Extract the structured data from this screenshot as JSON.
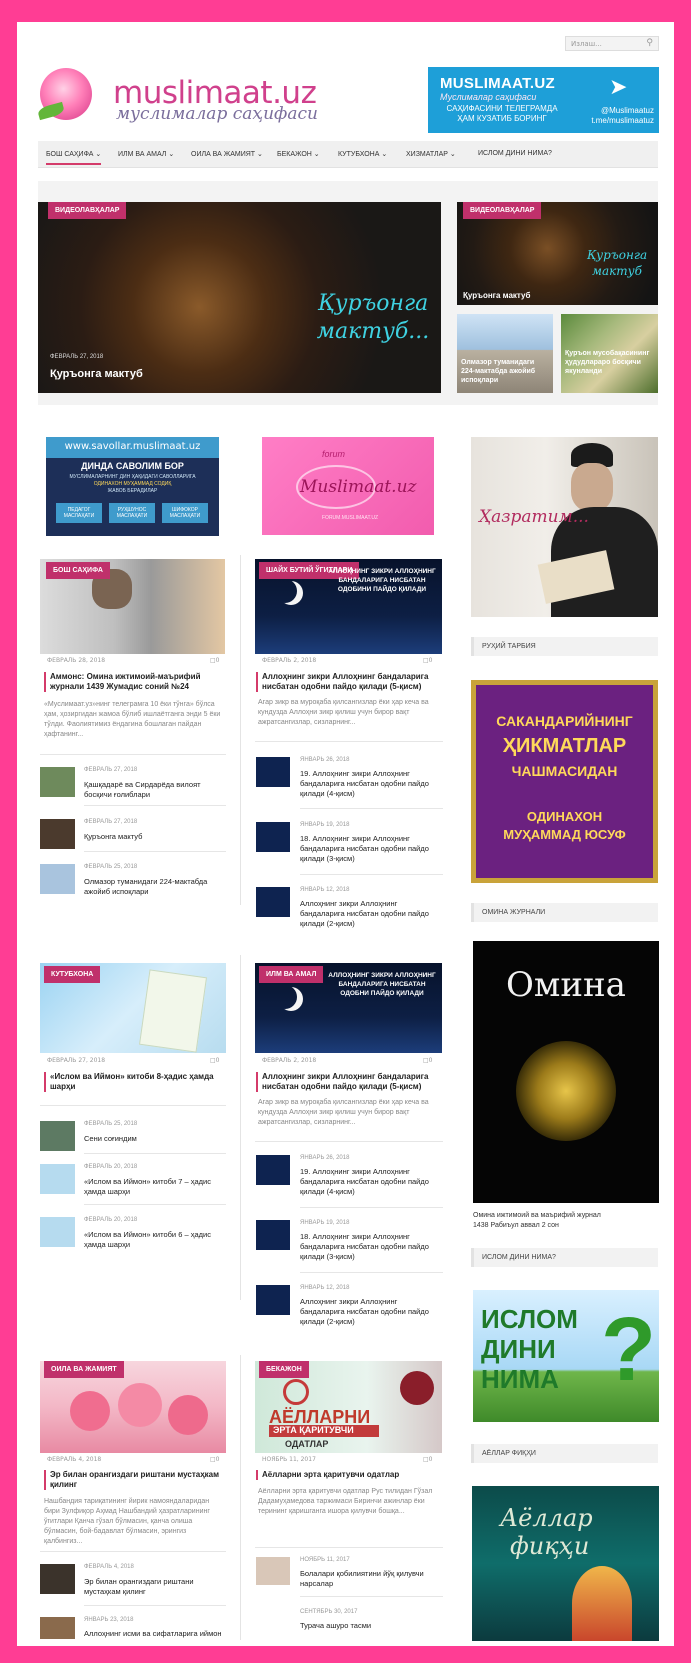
{
  "search": {
    "placeholder": "Излаш..."
  },
  "logo": {
    "title": "muslimaat.uz",
    "subtitle": "муслималар саҳифаси"
  },
  "telegram": {
    "title": "MUSLIMAAT.UZ",
    "subtitle": "Муслималар саҳифаси",
    "line1": "САҲИФАСИНИ ТЕЛЕГРАМДА",
    "line2": "ҲАМ КУЗАТИБ БОРИНГ",
    "handle": "@Muslimaatuz",
    "url": "t.me/muslimaatuz"
  },
  "nav": [
    {
      "label": "БОШ САҲИФА ⌄"
    },
    {
      "label": "ИЛМ ВА АМАЛ ⌄"
    },
    {
      "label": "ОИЛА ВА ЖАМИЯТ ⌄"
    },
    {
      "label": "БЕКАЖОН ⌄"
    },
    {
      "label": "КУТУБХОНА ⌄"
    },
    {
      "label": "ХИЗМАТЛАР ⌄"
    },
    {
      "label": "ИСЛОМ ДИНИ НИМА?"
    }
  ],
  "featured": {
    "main": {
      "tag": "ВИДЕОЛАВҲАЛАР",
      "date": "ФЕВРАЛЬ 27, 2018",
      "title": "Қуръонга мактуб",
      "art": "Қуръонга мактуб..."
    },
    "side1": {
      "tag": "ВИДЕОЛАВҲАЛАР",
      "title": "Қуръонга мактуб",
      "art": "Қуръонга мактуб"
    },
    "side2": {
      "title": "Олмазор туманидаги 224-мактабда ажойиб испоқлари"
    },
    "side3": {
      "title": "Қуръон мусобақасининг ҳудудлараро босқичи якунланди"
    }
  },
  "banners": {
    "savollar": {
      "url": "www.savollar.muslimaat.uz",
      "line1": "ДИНДА САВОЛИМ БОР",
      "line2": "МУСЛИМАЛАРНИНГ ДИН ҲАҚИДАГИ САВОЛЛАРИГА",
      "line3": "ОДИНАХОН МУҲАММАД СОДИҚ",
      "line4": "ЖАВОБ БЕРАДИЛАР",
      "b1": "ПЕДАГОГ МАСЛАҲАТИ",
      "b2": "РУҲШУНОС МАСЛАҲАТИ",
      "b3": "ШИФОКОР МАСЛАҲАТИ"
    },
    "forum": {
      "top": "forum",
      "name": "Muslimaat.uz",
      "url": "FORUM.MUSLIMAAT.UZ"
    },
    "hazrat": {
      "text": "Ҳазратим..."
    }
  },
  "col1a": {
    "tag": "БОШ САҲИФА",
    "date": "ФЕВРАЛЬ 28, 2018",
    "comments": "0",
    "title": "Аммонс: Омина ижтимоий-маърифий журнали 1439 Жумадис соний №24",
    "excerpt": "«Муслимаат.уз»нинг телеграмга 10 ёки тўнга» бўлса ҳам, ҳозиргидан жамоа бўлиб ишлаётганга энди 5 ёки тўлди. Фаолиятимиз ёндагина бошлаган пайдан ҳафтанинг...",
    "items": [
      {
        "date": "ФЕВРАЛЬ 27, 2018",
        "title": "Қашқадарё ва Сирдарёда вилоят босқичи ғолиблари"
      },
      {
        "date": "ФЕВРАЛЬ 27, 2018",
        "title": "Қуръонга мактуб"
      },
      {
        "date": "ФЕВРАЛЬ 25, 2018",
        "title": "Олмазор туманидаги 224-мактабда ажойиб испоқлари"
      }
    ]
  },
  "col2a": {
    "tag": "ШАЙХ БУТИЙ ЎГИТЛАРИ",
    "date": "ФЕВРАЛЬ 2, 2018",
    "comments": "0",
    "art": "АЛЛОҲНИНГ ЗИКРИ АЛЛОҲНИНГ БАНДАЛАРИГА НИСБАТАН ОДОБИНИ ПАЙДО ҚИЛАДИ",
    "title": "Аллоҳнинг зикри Аллоҳнинг бандаларига нисбатан одобни пайдо қилади (5-қисм)",
    "excerpt": "Агар зикр ва муроқаба қилсангизлар ёки ҳар кеча ва кундузда Аллоҳни зикр қилиш учун бирор вақт ажратсангизлар, сизларнинг...",
    "items": [
      {
        "date": "ЯНВАРЬ 26, 2018",
        "title": "19. Аллоҳнинг зикри Аллоҳнинг бандаларига нисбатан одобни пайдо қилади (4-қисм)"
      },
      {
        "date": "ЯНВАРЬ 19, 2018",
        "title": "18. Аллоҳнинг зикри Аллоҳнинг бандаларига нисбатан одобни пайдо қилади (3-қисм)"
      },
      {
        "date": "ЯНВАРЬ 12, 2018",
        "title": "Аллоҳнинг зикри Аллоҳнинг бандаларига нисбатан одобни пайдо қилади (2-қисм)"
      }
    ]
  },
  "col1b": {
    "tag": "КУТУБХОНА",
    "date": "ФЕВРАЛЬ 27, 2018",
    "comments": "0",
    "title": "«Ислом ва Иймон» китоби 8-ҳадис ҳамда шарҳи",
    "items": [
      {
        "date": "ФЕВРАЛЬ 25, 2018",
        "title": "Сени соғиндим"
      },
      {
        "date": "ФЕВРАЛЬ 20, 2018",
        "title": "«Ислом ва Иймон» китоби 7 – ҳадис ҳамда шарҳи"
      },
      {
        "date": "ФЕВРАЛЬ 20, 2018",
        "title": "«Ислом ва Иймон» китоби 6 – ҳадис ҳамда шарҳи"
      }
    ]
  },
  "col2b": {
    "tag": "ИЛМ ВА АМАЛ",
    "date": "ФЕВРАЛЬ 2, 2018",
    "comments": "0",
    "art": "АЛЛОҲНИНГ ЗИКРИ АЛЛОҲНИНГ БАНДАЛАРИГА НИСБАТАН ОДОБНИ ПАЙДО ҚИЛАДИ",
    "title": "Аллоҳнинг зикри Аллоҳнинг бандаларига нисбатан одобни пайдо қилади (5-қисм)",
    "excerpt": "Агар зикр ва муроқаба қилсангизлар ёки ҳар кеча ва кундузда Аллоҳни зикр қилиш учун бирор вақт ажратсангизлар, сизларнинг...",
    "items": [
      {
        "date": "ЯНВАРЬ 26, 2018",
        "title": "19. Аллоҳнинг зикри Аллоҳнинг бандаларига нисбатан одобни пайдо қилади (4-қисм)"
      },
      {
        "date": "ЯНВАРЬ 19, 2018",
        "title": "18. Аллоҳнинг зикри Аллоҳнинг бандаларига нисбатан одобни пайдо қилади (3-қисм)"
      },
      {
        "date": "ЯНВАРЬ 12, 2018",
        "title": "Аллоҳнинг зикри Аллоҳнинг бандаларига нисбатан одобни пайдо қилади (2-қисм)"
      }
    ]
  },
  "col1c": {
    "tag": "ОИЛА ВА ЖАМИЯТ",
    "date": "ФЕВРАЛЬ 4, 2018",
    "comments": "0",
    "title": "Эр билан орангиздаги риштани мустаҳкам қилинг",
    "excerpt": "Нашбандия тариқатининг йирик намояндаларидан бири Зулфиқор Аҳмад Нашбандий ҳазратларининг ўгитлари Қанча гўзал бўлмасин, қанча олиша бўлмасин, бой-бадавлат бўлмасин, эрингиз қалбингиз...",
    "items": [
      {
        "date": "ФЕВРАЛЬ 4, 2018",
        "title": "Эр билан орангиздаги риштани мустаҳкам қилинг"
      },
      {
        "date": "ЯНВАРЬ 23, 2018",
        "title": "Аллоҳнинг исми ва сифатларига иймон"
      }
    ]
  },
  "col2c": {
    "tag": "БЕКАЖОН",
    "date": "НОЯБРЬ 11, 2017",
    "comments": "0",
    "art1": "АЁЛЛАРНИ",
    "art2": "ЭРТА ҚАРИТУВЧИ",
    "art3": "ОДАТЛАР",
    "title": "Аёлларни эрта қаритувчи одатлар",
    "excerpt": "Аёлларни эрта қаритувчи одатлар Рус тилидан Гўзал Дадамуҳамедова таржимаси Биринчи ажинлар ёки терининг қаришганга ишора қилувчи бошқа...",
    "items": [
      {
        "date": "НОЯБРЬ 11, 2017",
        "title": "Болалари қобилиятини йўқ қилувчи нарсалар"
      },
      {
        "date": "СЕНТЯБРЬ 30, 2017",
        "title": "Турача ашуро тасми"
      }
    ]
  },
  "sidebar": {
    "ruhiy": "РУҲИЙ ТАРБИЯ",
    "sak1": "САКАНДАРИЙНИНГ",
    "sak2": "ҲИКМАТЛАР",
    "sak3": "ЧАШМАСИДАН",
    "sak4": "ОДИНАХОН",
    "sak5": "МУҲАММАД ЮСУФ",
    "omina_title": "ОМИНА ЖУРНАЛИ",
    "omina_logo": "Омина",
    "omina_caption1": "Омина ижтимоий ва маърифий журнал",
    "omina_caption2": "1438 Рабиъул аввал 2 сон",
    "islom_title": "ИСЛОМ ДИНИ НИМА?",
    "islom1": "ИСЛОМ",
    "islom2": "ДИНИ",
    "islom3": "НИМА",
    "fiqh_title": "АЁЛЛАР ФИҚҲИ",
    "fiqh1": "Аёллар",
    "fiqh2": "фиқҳи"
  },
  "colors": {
    "frame": "#ff3d94",
    "accent": "#c0306b",
    "telegram": "#1e9fd8"
  }
}
